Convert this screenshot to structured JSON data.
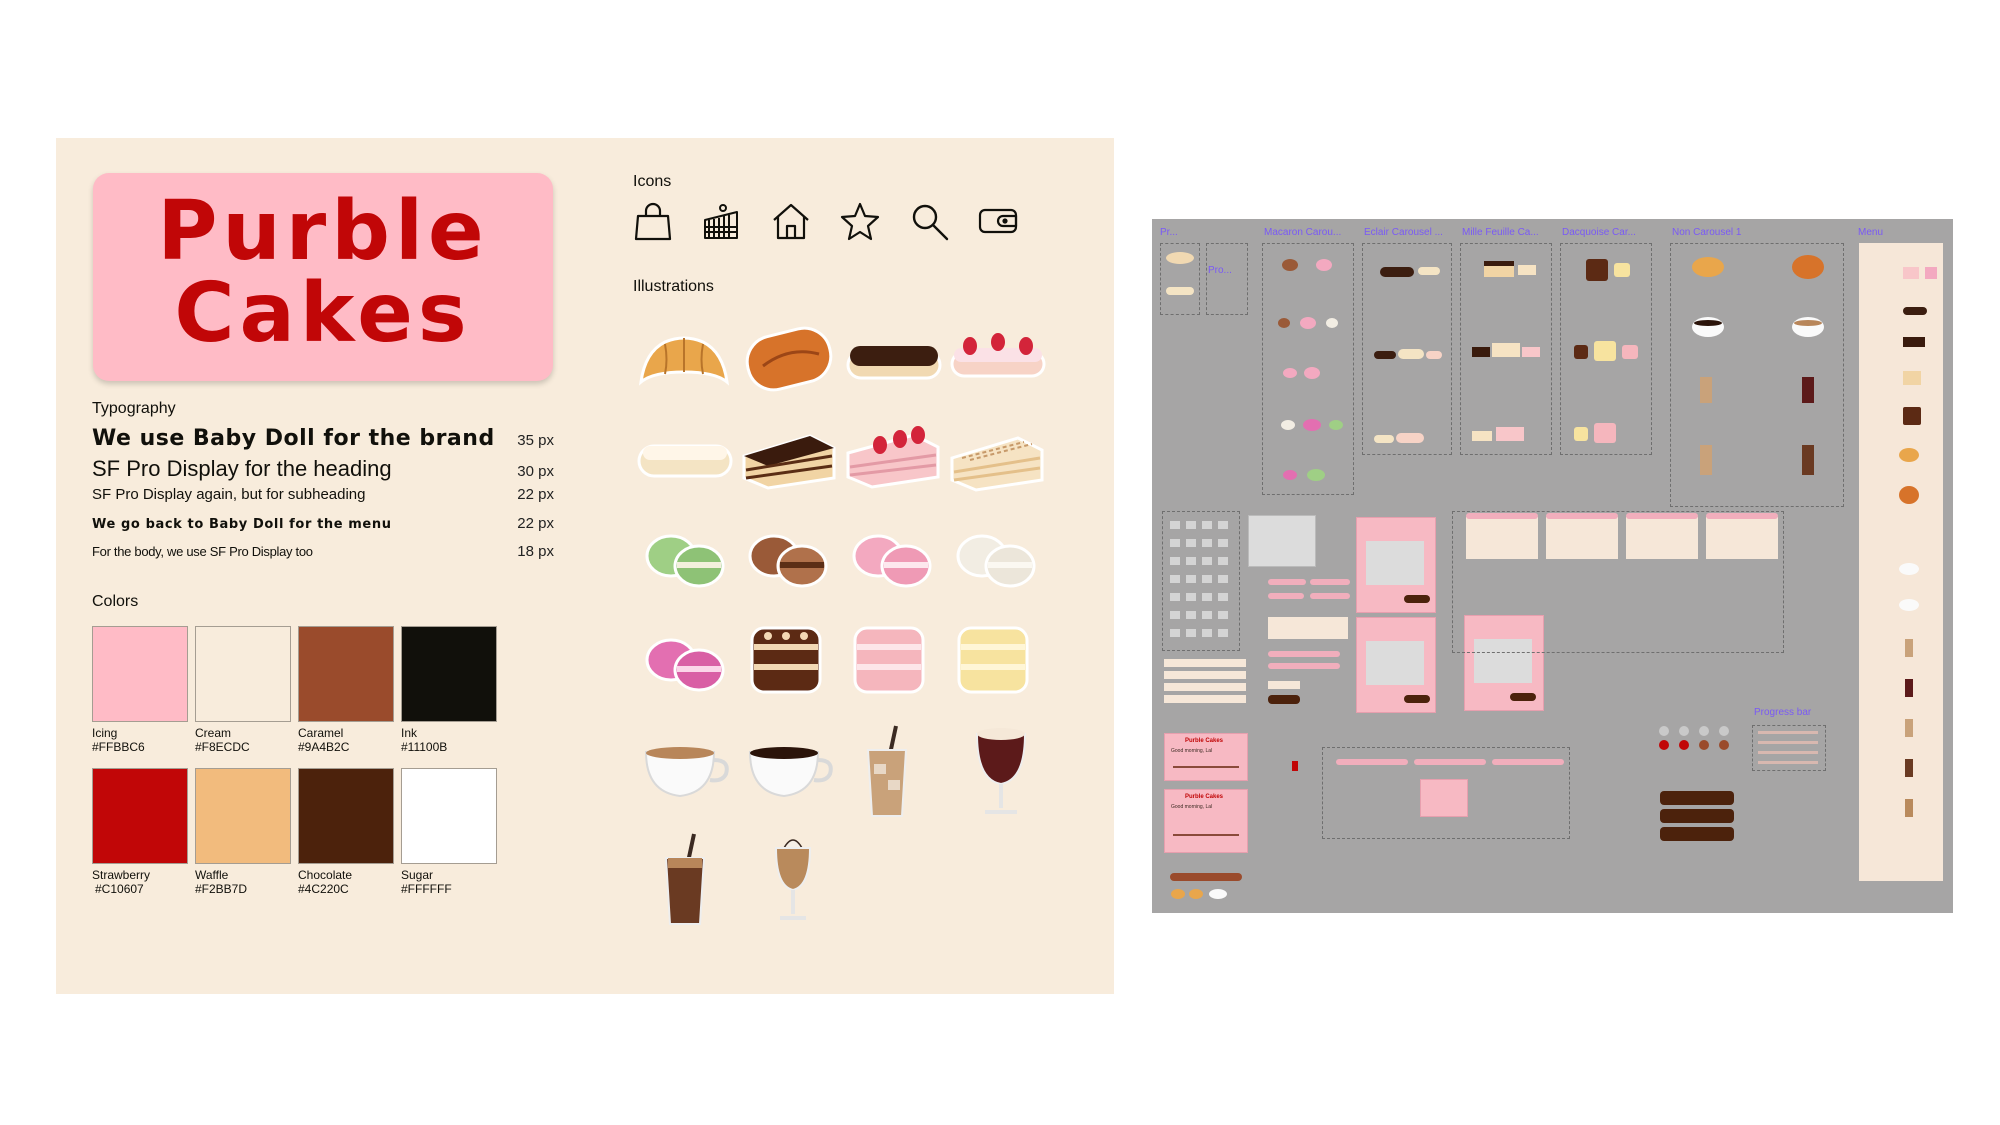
{
  "brand": {
    "name_line1": "Purble",
    "name_line2": "Cakes"
  },
  "sections": {
    "typography": "Typography",
    "colors": "Colors",
    "icons": "Icons",
    "illustrations": "Illustrations"
  },
  "typography": [
    {
      "text": "We use Baby Doll for the brand",
      "size": "35 px"
    },
    {
      "text": "SF Pro Display for the heading",
      "size": "30 px"
    },
    {
      "text": "SF Pro Display again, but for subheading",
      "size": "22 px"
    },
    {
      "text": "We go back to Baby Doll for the menu",
      "size": "22 px"
    },
    {
      "text": "For the body, we use SF Pro Display too",
      "size": "18 px"
    }
  ],
  "colors": [
    {
      "name": "Icing",
      "hex": "#FFBBC6"
    },
    {
      "name": "Cream",
      "hex": "#F8ECDC"
    },
    {
      "name": "Caramel",
      "hex": "#9A4B2C"
    },
    {
      "name": "Ink",
      "hex": "#11100B"
    },
    {
      "name": "Strawberry",
      "hex": "#C10607"
    },
    {
      "name": "Waffle",
      "hex": "#F2BB7D"
    },
    {
      "name": "Chocolate",
      "hex": "#4C220C"
    },
    {
      "name": "Sugar",
      "hex": "#FFFFFF"
    }
  ],
  "icons": [
    "shopping-bag-icon",
    "cake-slice-icon",
    "home-icon",
    "star-icon",
    "search-icon",
    "wallet-icon"
  ],
  "illustrations": [
    "croissant",
    "pain-au-chocolat",
    "chocolate-eclair",
    "strawberry-eclair",
    "vanilla-eclair",
    "chocolate-mille-feuille",
    "strawberry-mille-feuille",
    "vanilla-mille-feuille",
    "pistachio-macaron",
    "chocolate-macaron",
    "rose-macaron",
    "vanilla-macaron",
    "raspberry-macaron",
    "chocolate-dacquoise",
    "strawberry-dacquoise",
    "lemon-dacquoise",
    "cappuccino",
    "espresso",
    "iced-latte",
    "irish-coffee",
    "iced-mocha",
    "frappe"
  ],
  "canvas": {
    "frames": [
      "Pr...",
      "Macaron Carou...",
      "Eclair Carousel ...",
      "Mille Feuille Ca...",
      "Dacquoise Car...",
      "Non Carousel 1",
      "Menu",
      "Pro...",
      "Progress bar"
    ],
    "brand_card": "Purble Cakes",
    "greeting": "Good morning, Lal"
  }
}
